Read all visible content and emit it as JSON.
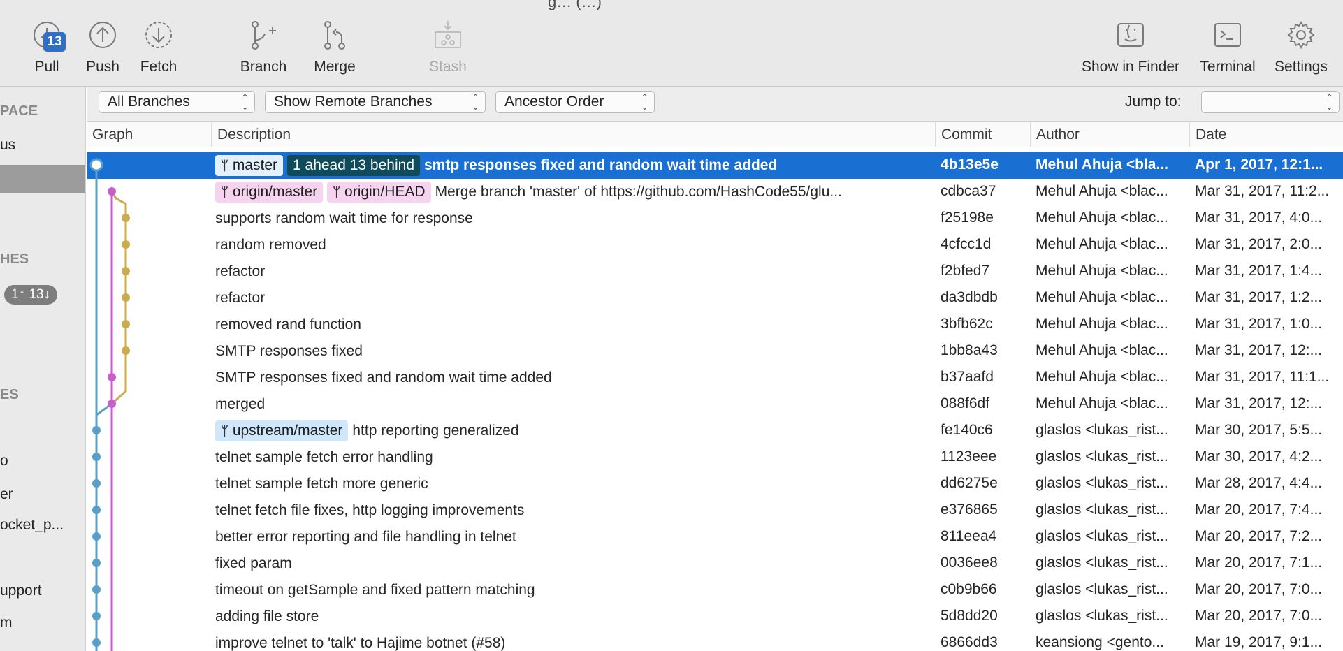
{
  "window": {
    "title_fragment": "g… (…)"
  },
  "toolbar": {
    "pull": {
      "label": "Pull",
      "badge": "13",
      "icon": "pull-icon"
    },
    "push": {
      "label": "Push",
      "icon": "push-icon"
    },
    "fetch": {
      "label": "Fetch",
      "icon": "fetch-icon"
    },
    "branch": {
      "label": "Branch",
      "icon": "branch-icon"
    },
    "merge": {
      "label": "Merge",
      "icon": "merge-icon"
    },
    "stash": {
      "label": "Stash",
      "icon": "stash-icon"
    },
    "show_in_finder": {
      "label": "Show in Finder",
      "icon": "finder-icon"
    },
    "terminal": {
      "label": "Terminal",
      "icon": "terminal-icon"
    },
    "settings": {
      "label": "Settings",
      "icon": "gear-icon"
    }
  },
  "sidebar": {
    "workspace_header": "PACE",
    "workspace_item": "us",
    "branches_header": "HES",
    "branch_badge": "1↑ 13↓",
    "remotes_header": "ES",
    "items": [
      "o",
      "er",
      "ocket_p...",
      "upport",
      "m"
    ]
  },
  "filters": {
    "branches": "All Branches",
    "remote": "Show Remote Branches",
    "order": "Ancestor Order",
    "jump_label": "Jump to:",
    "jump_value": ""
  },
  "columns": {
    "graph": "Graph",
    "description": "Description",
    "commit": "Commit",
    "author": "Author",
    "date": "Date"
  },
  "commits": [
    {
      "tags": [
        {
          "text": "master",
          "style": "blue",
          "branch": true
        },
        {
          "text": "1 ahead 13 behind",
          "style": "dark",
          "branch": false
        }
      ],
      "message": "smtp responses fixed and random wait time added",
      "hash": "4b13e5e",
      "author": "Mehul Ahuja <bla...",
      "date": "Apr 1, 2017, 12:1...",
      "selected": true
    },
    {
      "tags": [
        {
          "text": "origin/master",
          "style": "pink",
          "branch": true
        },
        {
          "text": "origin/HEAD",
          "style": "pink",
          "branch": true
        }
      ],
      "message": "Merge branch 'master' of https://github.com/HashCode55/glu...",
      "hash": "cdbca37",
      "author": "Mehul Ahuja <blac...",
      "date": "Mar 31, 2017, 11:2..."
    },
    {
      "tags": [],
      "message": "supports random wait time for response",
      "hash": "f25198e",
      "author": "Mehul Ahuja <blac...",
      "date": "Mar 31, 2017, 4:0..."
    },
    {
      "tags": [],
      "message": "random removed",
      "hash": "4cfcc1d",
      "author": "Mehul Ahuja <blac...",
      "date": "Mar 31, 2017, 2:0..."
    },
    {
      "tags": [],
      "message": "refactor",
      "hash": "f2bfed7",
      "author": "Mehul Ahuja <blac...",
      "date": "Mar 31, 2017, 1:4..."
    },
    {
      "tags": [],
      "message": "refactor",
      "hash": "da3dbdb",
      "author": "Mehul Ahuja <blac...",
      "date": "Mar 31, 2017, 1:2..."
    },
    {
      "tags": [],
      "message": "removed rand function",
      "hash": "3bfb62c",
      "author": "Mehul Ahuja <blac...",
      "date": "Mar 31, 2017, 1:0..."
    },
    {
      "tags": [],
      "message": "SMTP responses fixed",
      "hash": "1bb8a43",
      "author": "Mehul Ahuja <blac...",
      "date": "Mar 31, 2017, 12:..."
    },
    {
      "tags": [],
      "message": "SMTP responses fixed and random wait time added",
      "hash": "b37aafd",
      "author": "Mehul Ahuja <blac...",
      "date": "Mar 31, 2017, 11:1..."
    },
    {
      "tags": [],
      "message": "merged",
      "hash": "088f6df",
      "author": "Mehul Ahuja <blac...",
      "date": "Mar 31, 2017, 12:..."
    },
    {
      "tags": [
        {
          "text": "upstream/master",
          "style": "blue",
          "branch": true
        }
      ],
      "message": "http reporting generalized",
      "hash": "fe140c6",
      "author": "glaslos <lukas_rist...",
      "date": "Mar 30, 2017, 5:5..."
    },
    {
      "tags": [],
      "message": "telnet sample fetch error handling",
      "hash": "1123eee",
      "author": "glaslos <lukas_rist...",
      "date": "Mar 30, 2017, 4:2..."
    },
    {
      "tags": [],
      "message": "telnet sample fetch more generic",
      "hash": "dd6275e",
      "author": "glaslos <lukas_rist...",
      "date": "Mar 28, 2017, 4:4..."
    },
    {
      "tags": [],
      "message": "telnet fetch file fixes, http logging improvements",
      "hash": "e376865",
      "author": "glaslos <lukas_rist...",
      "date": "Mar 20, 2017, 7:4..."
    },
    {
      "tags": [],
      "message": "better error reporting and file handling in telnet",
      "hash": "811eea4",
      "author": "glaslos <lukas_rist...",
      "date": "Mar 20, 2017, 7:2..."
    },
    {
      "tags": [],
      "message": "fixed param",
      "hash": "0036ee8",
      "author": "glaslos <lukas_rist...",
      "date": "Mar 20, 2017, 7:1..."
    },
    {
      "tags": [],
      "message": "timeout on getSample and fixed pattern matching",
      "hash": "c0b9b66",
      "author": "glaslos <lukas_rist...",
      "date": "Mar 20, 2017, 7:0..."
    },
    {
      "tags": [],
      "message": "adding file store",
      "hash": "5d8dd20",
      "author": "glaslos <lukas_rist...",
      "date": "Mar 20, 2017, 7:0..."
    },
    {
      "tags": [],
      "message": "improve telnet to 'talk' to Hajime botnet (#58)",
      "hash": "6866dd3",
      "author": "keansiong <gento...",
      "date": "Mar 19, 2017, 9:1..."
    }
  ],
  "graph_colors": {
    "blue": "#5a9fc8",
    "magenta": "#c560c8",
    "gold": "#c9ac52"
  }
}
